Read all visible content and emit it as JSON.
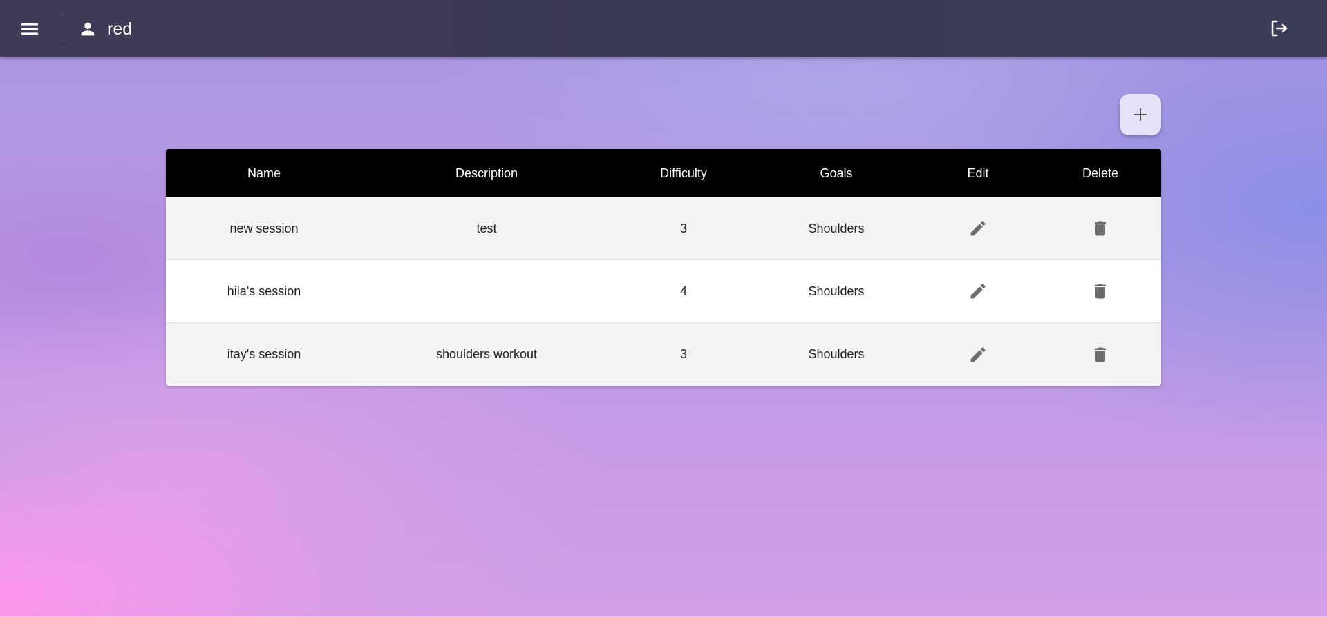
{
  "header": {
    "username": "red",
    "icons": {
      "menu": "hamburger-menu-icon",
      "user": "person-icon",
      "logout": "logout-icon"
    },
    "colors": {
      "bar": "#3c3b54",
      "text": "#ffffff"
    }
  },
  "actions": {
    "add_icon": "plus-icon"
  },
  "table": {
    "columns": [
      "Name",
      "Description",
      "Difficulty",
      "Goals",
      "Edit",
      "Delete"
    ],
    "rows": [
      {
        "name": "new session",
        "description": "test",
        "difficulty": "3",
        "goals": "Shoulders"
      },
      {
        "name": "hila's session",
        "description": "",
        "difficulty": "4",
        "goals": "Shoulders"
      },
      {
        "name": "itay's session",
        "description": "shoulders workout",
        "difficulty": "3",
        "goals": "Shoulders"
      }
    ],
    "row_icons": {
      "edit": "pencil-icon",
      "delete": "trash-icon"
    },
    "colors": {
      "header_bg": "#000000",
      "row_odd": "#f3f3f3",
      "row_even": "#ffffff",
      "icon": "#6b6b6b"
    }
  }
}
